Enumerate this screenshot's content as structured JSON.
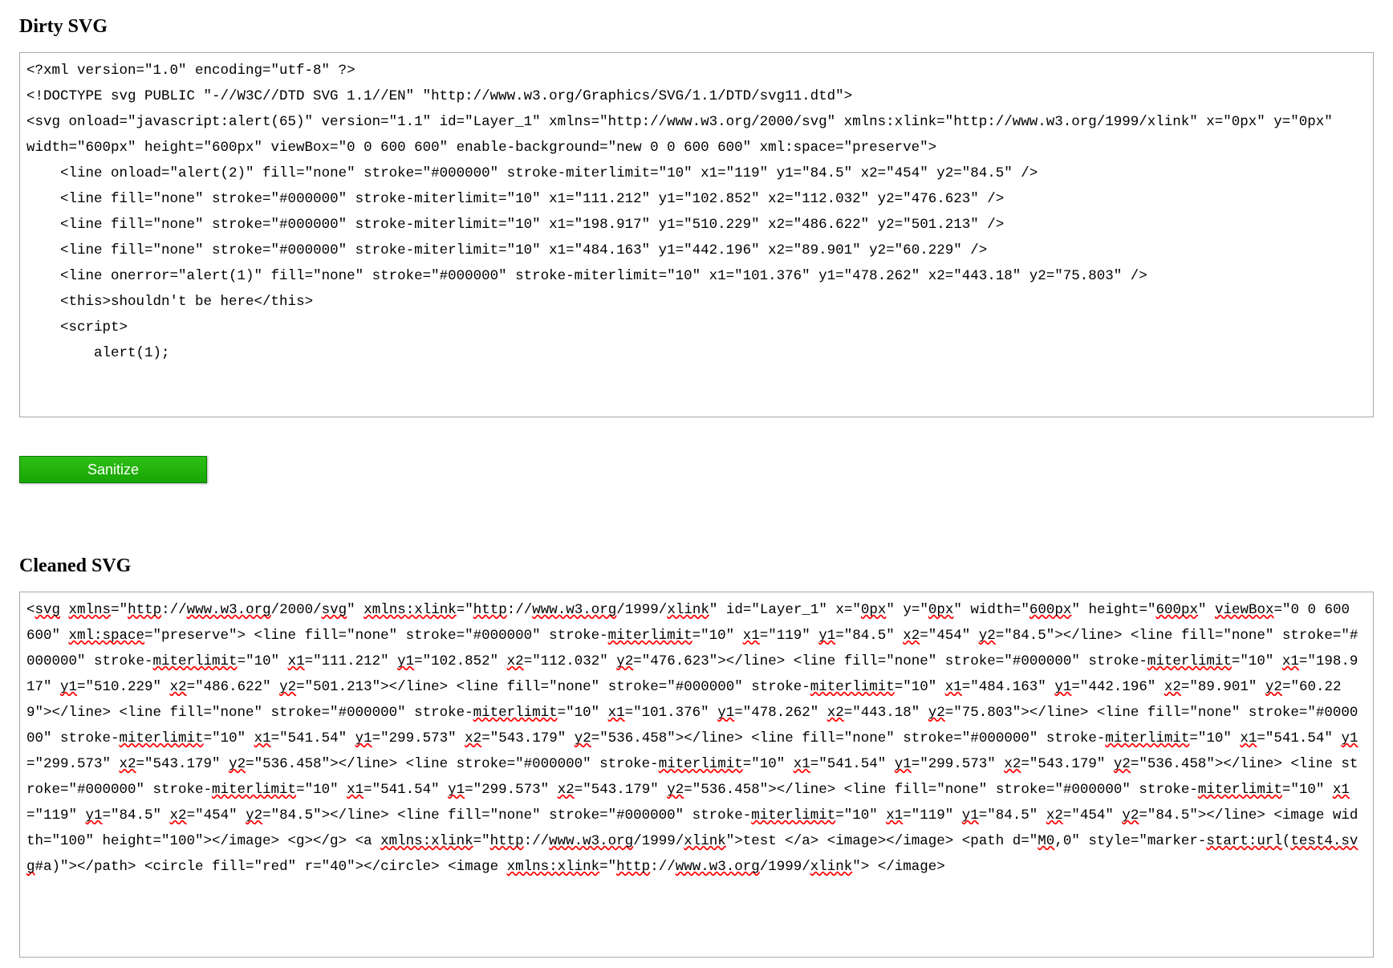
{
  "dirty": {
    "title": "Dirty SVG",
    "content": "<?xml version=\"1.0\" encoding=\"utf-8\" ?>\n<!DOCTYPE svg PUBLIC \"-//W3C//DTD SVG 1.1//EN\" \"http://www.w3.org/Graphics/SVG/1.1/DTD/svg11.dtd\">\n<svg onload=\"javascript:alert(65)\" version=\"1.1\" id=\"Layer_1\" xmlns=\"http://www.w3.org/2000/svg\" xmlns:xlink=\"http://www.w3.org/1999/xlink\" x=\"0px\" y=\"0px\" width=\"600px\" height=\"600px\" viewBox=\"0 0 600 600\" enable-background=\"new 0 0 600 600\" xml:space=\"preserve\">\n    <line onload=\"alert(2)\" fill=\"none\" stroke=\"#000000\" stroke-miterlimit=\"10\" x1=\"119\" y1=\"84.5\" x2=\"454\" y2=\"84.5\" />\n    <line fill=\"none\" stroke=\"#000000\" stroke-miterlimit=\"10\" x1=\"111.212\" y1=\"102.852\" x2=\"112.032\" y2=\"476.623\" />\n    <line fill=\"none\" stroke=\"#000000\" stroke-miterlimit=\"10\" x1=\"198.917\" y1=\"510.229\" x2=\"486.622\" y2=\"501.213\" />\n    <line fill=\"none\" stroke=\"#000000\" stroke-miterlimit=\"10\" x1=\"484.163\" y1=\"442.196\" x2=\"89.901\" y2=\"60.229\" />\n    <line onerror=\"alert(1)\" fill=\"none\" stroke=\"#000000\" stroke-miterlimit=\"10\" x1=\"101.376\" y1=\"478.262\" x2=\"443.18\" y2=\"75.803\" />\n    <this>shouldn't be here</this>\n    <script>\n        alert(1);\n"
  },
  "button": {
    "label": "Sanitize"
  },
  "cleaned": {
    "title": "Cleaned SVG",
    "tokens": [
      {
        "t": "<"
      },
      {
        "t": "svg",
        "u": true
      },
      {
        "t": " "
      },
      {
        "t": "xmlns",
        "u": true
      },
      {
        "t": "=\""
      },
      {
        "t": "http",
        "u": true
      },
      {
        "t": "://"
      },
      {
        "t": "www.w3.org",
        "u": true
      },
      {
        "t": "/2000/"
      },
      {
        "t": "svg",
        "u": true
      },
      {
        "t": "\" "
      },
      {
        "t": "xmlns:xlink",
        "u": true
      },
      {
        "t": "=\""
      },
      {
        "t": "http",
        "u": true
      },
      {
        "t": "://"
      },
      {
        "t": "www.w3.org",
        "u": true
      },
      {
        "t": "/1999/"
      },
      {
        "t": "xlink",
        "u": true
      },
      {
        "t": "\" id=\"Layer_1\" x=\""
      },
      {
        "t": "0px",
        "u": true
      },
      {
        "t": "\" y=\""
      },
      {
        "t": "0px",
        "u": true
      },
      {
        "t": "\" width=\""
      },
      {
        "t": "600px",
        "u": true
      },
      {
        "t": "\" height=\""
      },
      {
        "t": "600px",
        "u": true
      },
      {
        "t": "\" "
      },
      {
        "t": "viewBox",
        "u": true
      },
      {
        "t": "=\"0 0 600 600\" "
      },
      {
        "t": "xml:space",
        "u": true
      },
      {
        "t": "=\"preserve\"> <line fill=\"none\" stroke=\"#000000\" stroke-"
      },
      {
        "t": "miterlimit",
        "u": true
      },
      {
        "t": "=\"10\" "
      },
      {
        "t": "x1",
        "u": true
      },
      {
        "t": "=\"119\" "
      },
      {
        "t": "y1",
        "u": true
      },
      {
        "t": "=\"84.5\" "
      },
      {
        "t": "x2",
        "u": true
      },
      {
        "t": "=\"454\" "
      },
      {
        "t": "y2",
        "u": true
      },
      {
        "t": "=\"84.5\"></line> <line fill=\"none\" stroke=\"#000000\" stroke-"
      },
      {
        "t": "miterlimit",
        "u": true
      },
      {
        "t": "=\"10\" "
      },
      {
        "t": "x1",
        "u": true
      },
      {
        "t": "=\"111.212\" "
      },
      {
        "t": "y1",
        "u": true
      },
      {
        "t": "=\"102.852\" "
      },
      {
        "t": "x2",
        "u": true
      },
      {
        "t": "=\"112.032\" "
      },
      {
        "t": "y2",
        "u": true
      },
      {
        "t": "=\"476.623\"></line> <line fill=\"none\" stroke=\"#000000\" stroke-"
      },
      {
        "t": "miterlimit",
        "u": true
      },
      {
        "t": "=\"10\" "
      },
      {
        "t": "x1",
        "u": true
      },
      {
        "t": "=\"198.917\" "
      },
      {
        "t": "y1",
        "u": true
      },
      {
        "t": "=\"510.229\" "
      },
      {
        "t": "x2",
        "u": true
      },
      {
        "t": "=\"486.622\" "
      },
      {
        "t": "y2",
        "u": true
      },
      {
        "t": "=\"501.213\"></line> <line fill=\"none\" stroke=\"#000000\" stroke-"
      },
      {
        "t": "miterlimit",
        "u": true
      },
      {
        "t": "=\"10\" "
      },
      {
        "t": "x1",
        "u": true
      },
      {
        "t": "=\"484.163\" "
      },
      {
        "t": "y1",
        "u": true
      },
      {
        "t": "=\"442.196\" "
      },
      {
        "t": "x2",
        "u": true
      },
      {
        "t": "=\"89.901\" "
      },
      {
        "t": "y2",
        "u": true
      },
      {
        "t": "=\"60.229\"></line> <line fill=\"none\" stroke=\"#000000\" stroke-"
      },
      {
        "t": "miterlimit",
        "u": true
      },
      {
        "t": "=\"10\" "
      },
      {
        "t": "x1",
        "u": true
      },
      {
        "t": "=\"101.376\" "
      },
      {
        "t": "y1",
        "u": true
      },
      {
        "t": "=\"478.262\" "
      },
      {
        "t": "x2",
        "u": true
      },
      {
        "t": "=\"443.18\" "
      },
      {
        "t": "y2",
        "u": true
      },
      {
        "t": "=\"75.803\"></line> <line fill=\"none\" stroke=\"#000000\" stroke-"
      },
      {
        "t": "miterlimit",
        "u": true
      },
      {
        "t": "=\"10\" "
      },
      {
        "t": "x1",
        "u": true
      },
      {
        "t": "=\"541.54\" "
      },
      {
        "t": "y1",
        "u": true
      },
      {
        "t": "=\"299.573\" "
      },
      {
        "t": "x2",
        "u": true
      },
      {
        "t": "=\"543.179\" "
      },
      {
        "t": "y2",
        "u": true
      },
      {
        "t": "=\"536.458\"></line> <line fill=\"none\" stroke=\"#000000\" stroke-"
      },
      {
        "t": "miterlimit",
        "u": true
      },
      {
        "t": "=\"10\" "
      },
      {
        "t": "x1",
        "u": true
      },
      {
        "t": "=\"541.54\" "
      },
      {
        "t": "y1",
        "u": true
      },
      {
        "t": "=\"299.573\" "
      },
      {
        "t": "x2",
        "u": true
      },
      {
        "t": "=\"543.179\" "
      },
      {
        "t": "y2",
        "u": true
      },
      {
        "t": "=\"536.458\"></line> <line stroke=\"#000000\" stroke-"
      },
      {
        "t": "miterlimit",
        "u": true
      },
      {
        "t": "=\"10\" "
      },
      {
        "t": "x1",
        "u": true
      },
      {
        "t": "=\"541.54\" "
      },
      {
        "t": "y1",
        "u": true
      },
      {
        "t": "=\"299.573\" "
      },
      {
        "t": "x2",
        "u": true
      },
      {
        "t": "=\"543.179\" "
      },
      {
        "t": "y2",
        "u": true
      },
      {
        "t": "=\"536.458\"></line> <line stroke=\"#000000\" stroke-"
      },
      {
        "t": "miterlimit",
        "u": true
      },
      {
        "t": "=\"10\" "
      },
      {
        "t": "x1",
        "u": true
      },
      {
        "t": "=\"541.54\" "
      },
      {
        "t": "y1",
        "u": true
      },
      {
        "t": "=\"299.573\" "
      },
      {
        "t": "x2",
        "u": true
      },
      {
        "t": "=\"543.179\" "
      },
      {
        "t": "y2",
        "u": true
      },
      {
        "t": "=\"536.458\"></line> <line fill=\"none\" stroke=\"#000000\" stroke-"
      },
      {
        "t": "miterlimit",
        "u": true
      },
      {
        "t": "=\"10\" "
      },
      {
        "t": "x1",
        "u": true
      },
      {
        "t": "=\"119\" "
      },
      {
        "t": "y1",
        "u": true
      },
      {
        "t": "=\"84.5\" "
      },
      {
        "t": "x2",
        "u": true
      },
      {
        "t": "=\"454\" "
      },
      {
        "t": "y2",
        "u": true
      },
      {
        "t": "=\"84.5\"></line> <line fill=\"none\" stroke=\"#000000\" stroke-"
      },
      {
        "t": "miterlimit",
        "u": true
      },
      {
        "t": "=\"10\" "
      },
      {
        "t": "x1",
        "u": true
      },
      {
        "t": "=\"119\" "
      },
      {
        "t": "y1",
        "u": true
      },
      {
        "t": "=\"84.5\" "
      },
      {
        "t": "x2",
        "u": true
      },
      {
        "t": "=\"454\" "
      },
      {
        "t": "y2",
        "u": true
      },
      {
        "t": "=\"84.5\"></line> <image width=\"100\" height=\"100\"></image> <g></g> <a "
      },
      {
        "t": "xmlns:xlink",
        "u": true
      },
      {
        "t": "=\""
      },
      {
        "t": "http",
        "u": true
      },
      {
        "t": "://"
      },
      {
        "t": "www.w3.org",
        "u": true
      },
      {
        "t": "/1999/"
      },
      {
        "t": "xlink",
        "u": true
      },
      {
        "t": "\">test </a> <image></image> <path d=\""
      },
      {
        "t": "M0",
        "u": true
      },
      {
        "t": ",0\" style=\"marker-"
      },
      {
        "t": "start:url",
        "u": true
      },
      {
        "t": "("
      },
      {
        "t": "test4.svg",
        "u": true
      },
      {
        "t": "#a)\"></path> <circle fill=\"red\" r=\"40\"></circle> <image "
      },
      {
        "t": "xmlns:xlink",
        "u": true
      },
      {
        "t": "=\""
      },
      {
        "t": "http",
        "u": true
      },
      {
        "t": "://"
      },
      {
        "t": "www.w3.org",
        "u": true
      },
      {
        "t": "/1999/"
      },
      {
        "t": "xlink",
        "u": true
      },
      {
        "t": "\"> </image> "
      }
    ]
  }
}
